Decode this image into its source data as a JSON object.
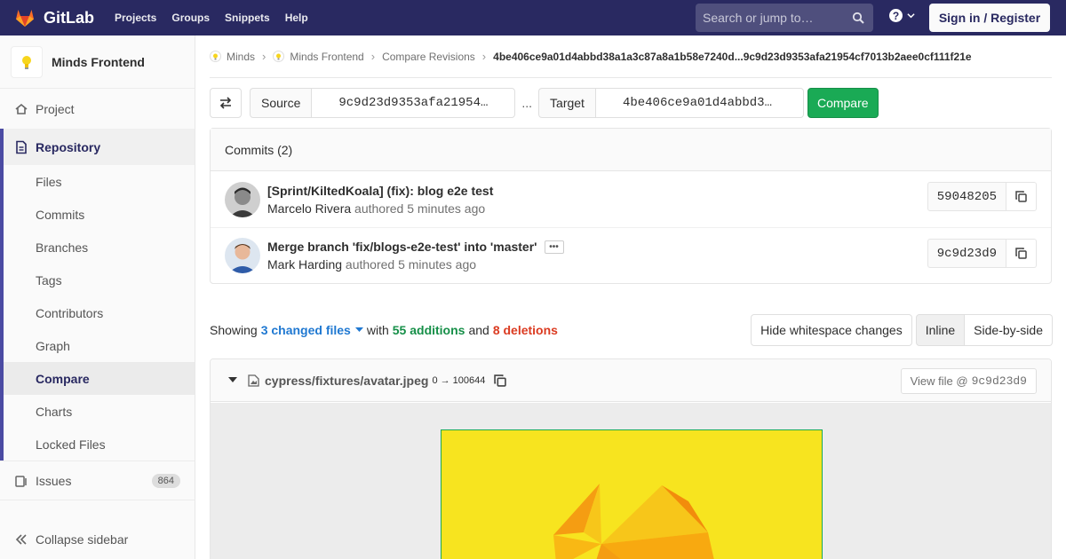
{
  "navbar": {
    "brand": "GitLab",
    "links": [
      "Projects",
      "Groups",
      "Snippets",
      "Help"
    ],
    "search_placeholder": "Search or jump to…",
    "signin": "Sign in / Register",
    "brand_color": "#292961"
  },
  "sidebar": {
    "project_name": "Minds Frontend",
    "project": "Project",
    "repository": "Repository",
    "repo_items": [
      "Files",
      "Commits",
      "Branches",
      "Tags",
      "Contributors",
      "Graph",
      "Compare",
      "Charts",
      "Locked Files"
    ],
    "active_item": "Compare",
    "issues": "Issues",
    "issues_count": "864",
    "collapse": "Collapse sidebar"
  },
  "breadcrumbs": [
    "Minds",
    "Minds Frontend",
    "Compare Revisions",
    "4be406ce9a01d4abbd38a1a3c87a8a1b58e7240d...9c9d23d9353afa21954cf7013b2aee0cf111f21e"
  ],
  "compare": {
    "source_label": "Source",
    "source_value": "9c9d23d9353afa21954…",
    "separator": "...",
    "target_label": "Target",
    "target_value": "4be406ce9a01d4abbd3…",
    "button": "Compare"
  },
  "commits": {
    "header": "Commits (2)",
    "items": [
      {
        "title": "[Sprint/KiltedKoala] (fix): blog e2e test",
        "author": "Marcelo Rivera",
        "authored": "authored",
        "time": "5 minutes ago",
        "sha": "59048205"
      },
      {
        "title": "Merge branch 'fix/blogs-e2e-test' into 'master'",
        "author": "Mark Harding",
        "authored": "authored",
        "time": "5 minutes ago",
        "sha": "9c9d23d9"
      }
    ]
  },
  "summary": {
    "showing": "Showing",
    "changed": "3 changed files",
    "with": "with",
    "additions": "55 additions",
    "and": "and",
    "deletions": "8 deletions",
    "hide_whitespace": "Hide whitespace changes",
    "inline": "Inline",
    "side_by_side": "Side-by-side"
  },
  "file": {
    "path": "cypress/fixtures/avatar.jpeg",
    "mode": "0 → 100644",
    "view_file_label": "View file @",
    "view_file_sha": "9c9d23d9"
  }
}
